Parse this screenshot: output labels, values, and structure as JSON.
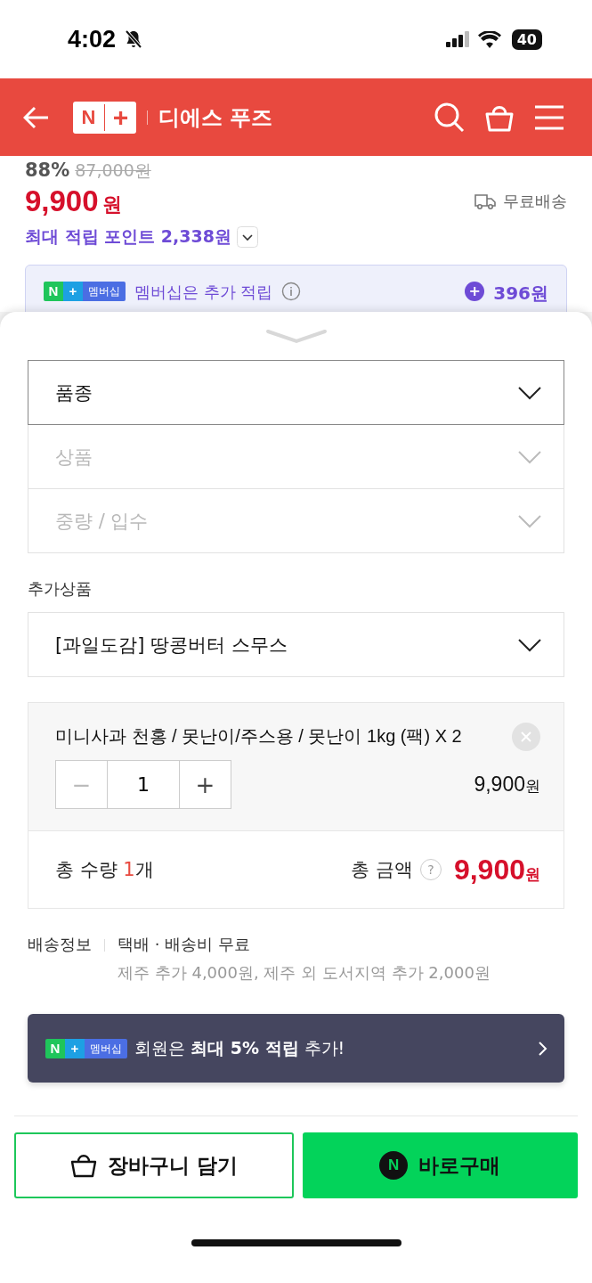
{
  "status_bar": {
    "time": "4:02",
    "battery": "40"
  },
  "header": {
    "logo": {
      "letter": "N",
      "plus": "+"
    },
    "shop_name": "디에스 푸즈"
  },
  "price": {
    "discount": "88%",
    "original": "87,000원",
    "current": "9,900",
    "currency": "원",
    "shipping": "무료배송",
    "points_label": "최대 적립 포인트 2,338원"
  },
  "membership_box": {
    "badge": {
      "letter": "N",
      "plus": "+",
      "label": "멤버십"
    },
    "text": "멤버십은 추가 적립",
    "plus_icon": "+",
    "amount": "396원"
  },
  "options": [
    {
      "label": "품종",
      "disabled": false
    },
    {
      "label": "상품",
      "disabled": true
    },
    {
      "label": "중량 / 입수",
      "disabled": true
    }
  ],
  "addon": {
    "label": "추가상품",
    "value": "[과일도감] 땅콩버터 스무스"
  },
  "selected_item": {
    "name": "미니사과 천홍 / 못난이/주스용 / 못난이 1kg (팩) X 2",
    "minus": "−",
    "quantity": "1",
    "plus": "+",
    "price": "9,900",
    "currency": "원"
  },
  "summary": {
    "qty_prefix": "총 수량 ",
    "qty": "1",
    "qty_suffix": "개",
    "total_label": "총 금액",
    "help": "?",
    "total": "9,900",
    "currency": "원"
  },
  "delivery": {
    "label": "배송정보",
    "method": "택배 · 배송비 무료",
    "note": "제주 추가 4,000원, 제주 외 도서지역 추가 2,000원"
  },
  "banner": {
    "badge": {
      "letter": "N",
      "plus": "+",
      "label": "멤버십"
    },
    "text": "회원은 **최대 5% 적립** 추가!"
  },
  "buttons": {
    "cart": "장바구니 담기",
    "buy_logo": "N",
    "buy": "바로구매"
  }
}
